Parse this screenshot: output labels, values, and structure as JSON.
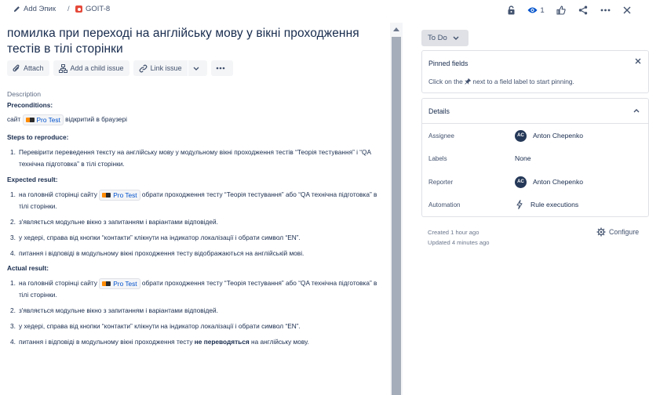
{
  "breadcrumb": {
    "add_epic": "Add Эпик",
    "separator": "/",
    "issue_key": "GOIT-8"
  },
  "header_actions": {
    "watchers_count": "1",
    "icons": [
      "lock-icon",
      "eye-icon",
      "thumbs-up-icon",
      "share-icon",
      "more-icon",
      "close-icon"
    ]
  },
  "issue": {
    "title": "помилка при переході на англійську мову у вікні проходження тестів в тілі сторінки"
  },
  "toolbar": {
    "attach": "Attach",
    "add_child": "Add a child issue",
    "link_issue": "Link issue"
  },
  "description": {
    "label": "Description",
    "preconditions_heading": "Preconditions:",
    "pre_prefix": "сайт",
    "link_text": "Pro Test",
    "pre_suffix": "відкритий в браузері",
    "steps_heading": "Steps to reproduce:",
    "steps": [
      {
        "num": "1.",
        "text": "Перевірити переведення тексту на англійську мову у модульному вікні  проходження тестів “Теорія тестування” і “QA технічна підготовка” в тілі сторінки."
      }
    ],
    "expected_heading": "Expected result:",
    "expected": {
      "item1_prefix": "на головній сторінці сайту",
      "item1_suffix": "обрати проходження тесту “Теорія тестування” або “QA технічна підготовка” в тілі сторінки.",
      "items": [
        {
          "num": "2.",
          "text": "з'являється модульне вікно з запитанням і варіантами відповідей."
        },
        {
          "num": "3.",
          "text": "у хедері, справа від кнопки “контакти” клікнути на індикатор локалізації і обрати символ “EN”."
        },
        {
          "num": "4.",
          "text": "питання і відповіді в модульному вікні проходження тесту відображаються на англійській мові."
        }
      ]
    },
    "actual_heading": "Actual result:",
    "actual": {
      "item1_prefix": "на головній сторінці сайту",
      "item1_suffix": "обрати проходження тесту “Теорія тестування” або “QA технічна підготовка” в тілі сторінки.",
      "items": [
        {
          "num": "2.",
          "text": "з'являється модульне вікно з запитанням і варіантами відповідей."
        },
        {
          "num": "3.",
          "text": "у хедері, справа від кнопки “контакти” клікнути на індикатор локалізації і обрати символ “EN”."
        }
      ],
      "item4_prefix": "питання і відповіді в модульному вікні проходження тесту",
      "item4_bold": "не переводяться",
      "item4_suffix": "на англійську мову."
    }
  },
  "sidebar": {
    "status": "To Do",
    "pinned": {
      "heading": "Pinned fields",
      "hint_prefix": "Click on the",
      "hint_suffix": "next to a field label to start pinning."
    },
    "details": {
      "heading": "Details",
      "rows": [
        {
          "key": "Assignee",
          "value": "Anton Chepenko",
          "avatar": "AC"
        },
        {
          "key": "Labels",
          "value": "None"
        },
        {
          "key": "Reporter",
          "value": "Anton Chepenko",
          "avatar": "AC"
        },
        {
          "key": "Automation",
          "value": "Rule executions"
        }
      ]
    },
    "created": "Created 1 hour ago",
    "updated": "Updated 4 minutes ago",
    "configure": "Configure"
  },
  "colors": {
    "text": "#172b4d",
    "subtle": "#42526e",
    "link": "#0052cc",
    "bug": "#e5493a",
    "avatar": "#253858"
  }
}
